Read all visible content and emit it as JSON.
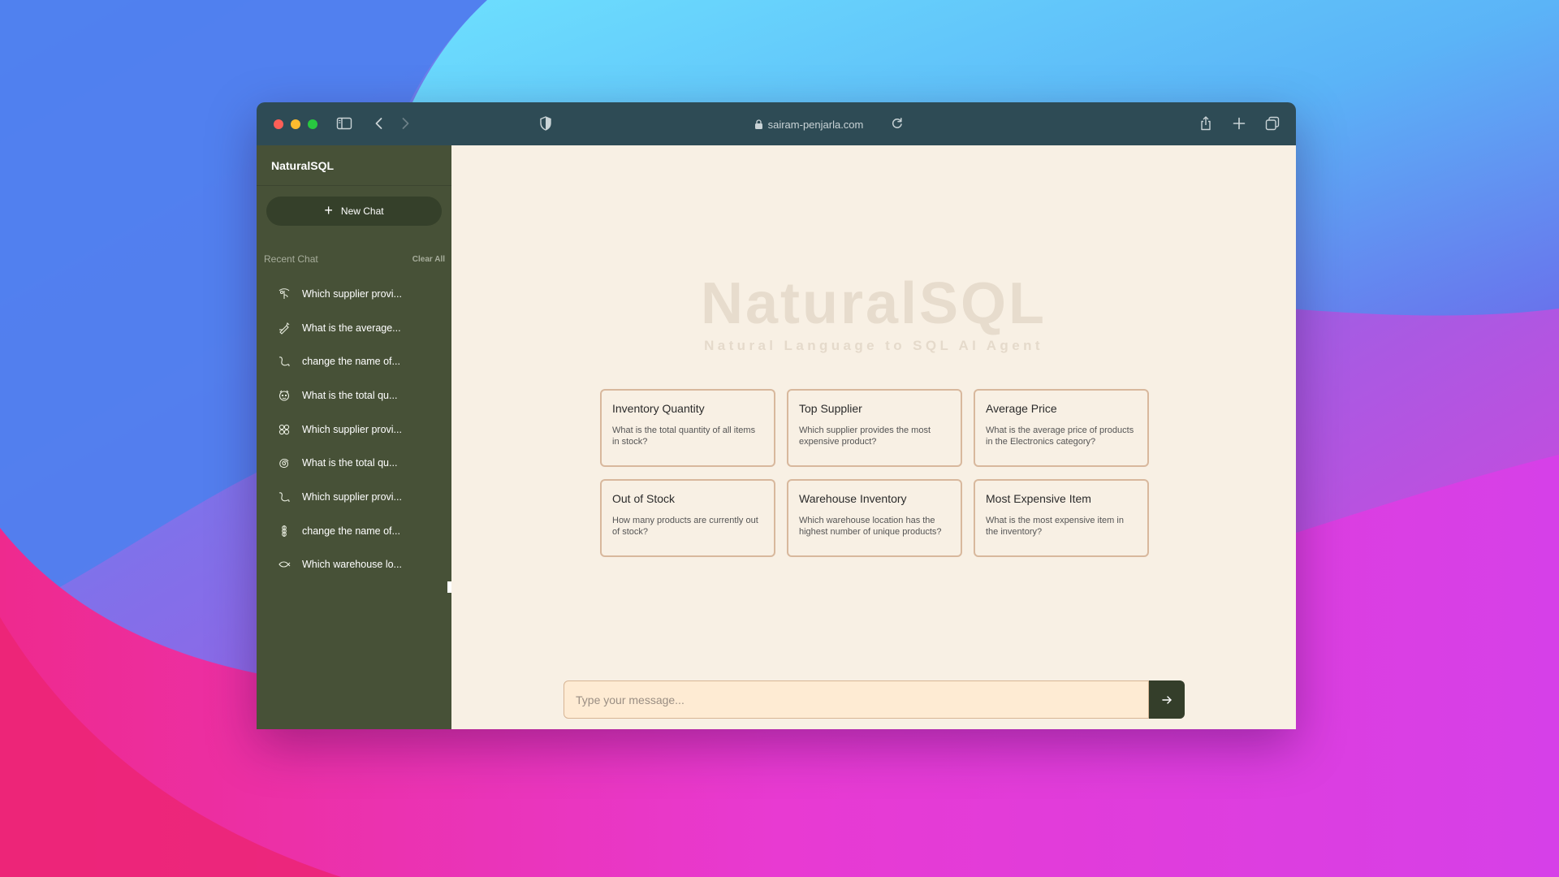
{
  "colors": {
    "sidebar_bg": "#475137",
    "main_bg": "#f8f0e4",
    "card_border": "#d8b89d",
    "send_button": "#343e2a",
    "titlebar": "#2e4b55"
  },
  "browser": {
    "url": "sairam-penjarla.com",
    "icons": [
      "sidebar-toggle-icon",
      "back-icon",
      "forward-icon",
      "shield-icon",
      "lock-icon",
      "reload-icon",
      "share-icon",
      "new-tab-icon",
      "tabs-overview-icon"
    ]
  },
  "sidebar": {
    "brand": "NaturalSQL",
    "new_chat_label": "New Chat",
    "recent_label": "Recent Chat",
    "clear_all_label": "Clear All",
    "chats": [
      {
        "label": "Which supplier provi...",
        "icon": "ornament-icon"
      },
      {
        "label": "What is the average...",
        "icon": "pen-icon"
      },
      {
        "label": "change the name of...",
        "icon": "squiggle-icon"
      },
      {
        "label": "What is the total qu...",
        "icon": "face-icon"
      },
      {
        "label": "Which supplier provi...",
        "icon": "flower-icon"
      },
      {
        "label": "What is the total qu...",
        "icon": "spiral-icon"
      },
      {
        "label": "Which supplier provi...",
        "icon": "squiggle-icon"
      },
      {
        "label": "change the name of...",
        "icon": "knot-icon"
      },
      {
        "label": "Which warehouse lo...",
        "icon": "fish-icon"
      }
    ]
  },
  "hero": {
    "title": "NaturalSQL",
    "subtitle": "Natural Language to SQL AI Agent"
  },
  "cards": [
    {
      "title": "Inventory Quantity",
      "description": "What is the total quantity of all items in stock?"
    },
    {
      "title": "Top Supplier",
      "description": "Which supplier provides the most expensive product?"
    },
    {
      "title": "Average Price",
      "description": "What is the average price of products in the Electronics category?"
    },
    {
      "title": "Out of Stock",
      "description": "How many products are currently out of stock?"
    },
    {
      "title": "Warehouse Inventory",
      "description": "Which warehouse location has the highest number of unique products?"
    },
    {
      "title": "Most Expensive Item",
      "description": "What is the most expensive item in the inventory?"
    }
  ],
  "composer": {
    "placeholder": "Type your message...",
    "value": ""
  }
}
